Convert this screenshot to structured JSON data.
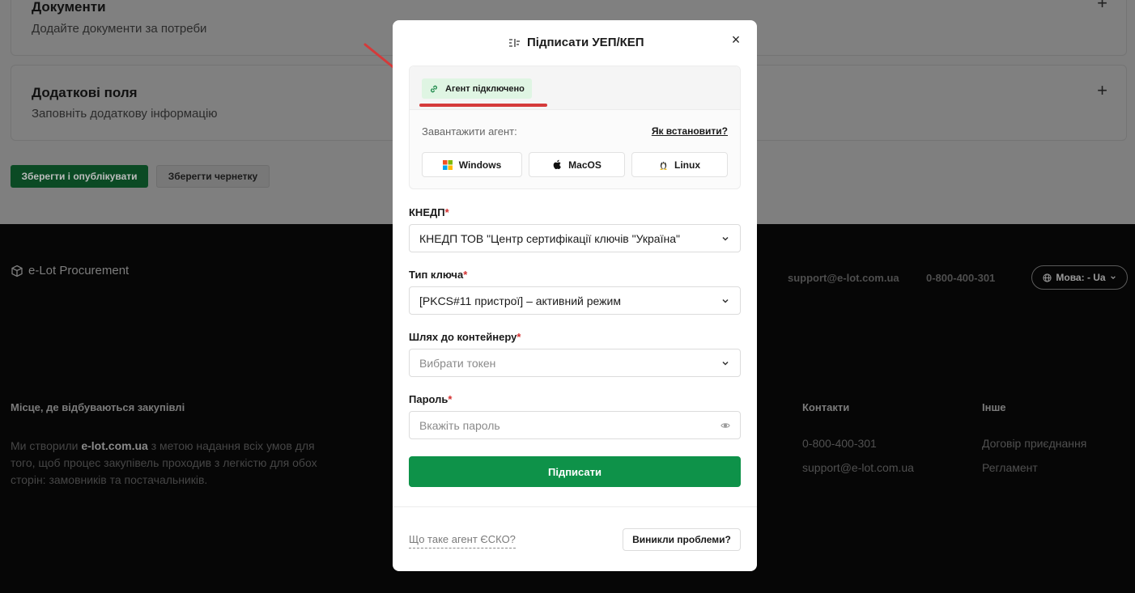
{
  "background": {
    "documents_card": {
      "title": "Документи",
      "subtitle": "Додайте документи за потреби",
      "expand_symbol": "+"
    },
    "extra_fields_card": {
      "title": "Додаткові поля",
      "subtitle": "Заповніть додаткову інформацію",
      "expand_symbol": "+"
    },
    "publish_button": "Зберегти і опублікувати",
    "draft_button": "Зберегти чернетку"
  },
  "footer": {
    "brand": "e-Lot Procurement",
    "email": "support@e-lot.com.ua",
    "phone": "0-800-400-301",
    "language_button": "Мова: - Ua",
    "tagline": "Місце, де відбуваються закупівлі",
    "description_before": "Ми створили ",
    "description_highlight": "e-lot.com.ua",
    "description_after": " з метою надання всіх умов для того, щоб процес закупівель проходив з легкістю для обох сторін: замовників та постачальників.",
    "contacts": {
      "title": "Контакти",
      "phone": "0-800-400-301",
      "email": "support@e-lot.com.ua"
    },
    "other": {
      "title": "Інше",
      "links": [
        "Договір приєднання",
        "Регламент"
      ]
    }
  },
  "modal": {
    "title": "Підписати УЕП/КЕП",
    "close_symbol": "×",
    "agent_status": "Агент підключено",
    "download_label": "Завантажити агент:",
    "how_to_install": "Як встановити?",
    "os_buttons": [
      "Windows",
      "MacOS",
      "Linux"
    ],
    "fields": {
      "ca": {
        "label": "КНЕДП",
        "value": "КНЕДП ТОВ \"Центр сертифікації ключів \"Україна\""
      },
      "key_type": {
        "label": "Тип ключа",
        "value": "[PKCS#11 пристрої] – активний режим"
      },
      "container": {
        "label": "Шлях до контейнеру",
        "placeholder": "Вибрати токен"
      },
      "password": {
        "label": "Пароль",
        "placeholder": "Вкажіть пароль"
      }
    },
    "required_mark": "*",
    "sign_button": "Підписати",
    "what_is_agent": "Що таке агент ЄСКО?",
    "problems_button": "Виникли проблеми?"
  },
  "colors": {
    "primary_green": "#0e9249",
    "badge_bg": "#dff5e3",
    "annotation_red": "#d53a3a",
    "required_red": "#d32f2f",
    "footer_bg": "#060606",
    "overlay_gray": "#808080"
  },
  "icons": [
    "plus-icon",
    "cube-icon",
    "globe-icon",
    "chevron-down-icon",
    "sign-icon",
    "close-icon",
    "link-icon",
    "windows-icon",
    "apple-icon",
    "linux-icon",
    "eye-icon"
  ]
}
